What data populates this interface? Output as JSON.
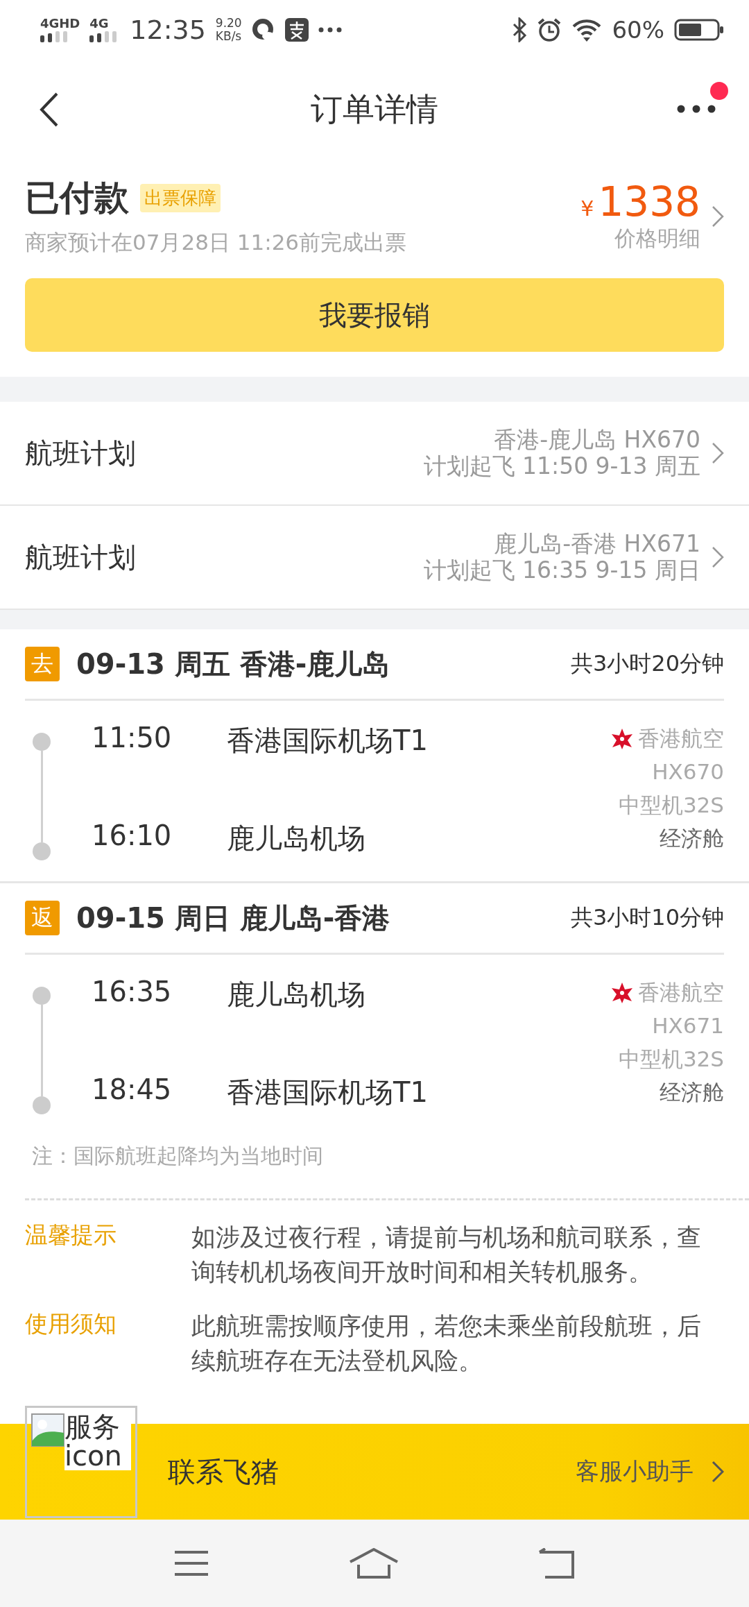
{
  "status_bar": {
    "network_1": "4GHD",
    "network_2": "4G",
    "time": "12:35",
    "speed": "9.20",
    "speed_unit": "KB/s",
    "battery": "60%"
  },
  "header": {
    "title": "订单详情",
    "notification_dot": true
  },
  "order": {
    "status": "已付款",
    "tag": "出票保障",
    "note": "商家预计在07月28日 11:26前完成出票",
    "price_currency": "¥",
    "price": "1338",
    "price_link": "价格明细",
    "button": "我要报销"
  },
  "flight_plans": [
    {
      "label": "航班计划",
      "route": "香港-鹿儿岛 HX670",
      "schedule": "计划起飞 11:50 9-13 周五"
    },
    {
      "label": "航班计划",
      "route": "鹿儿岛-香港 HX671",
      "schedule": "计划起飞 16:35 9-15 周日"
    }
  ],
  "segments": [
    {
      "badge": "去",
      "title": "09-13 周五 香港-鹿儿岛",
      "duration": "共3小时20分钟",
      "depart_time": "11:50",
      "depart_airport": "香港国际机场T1",
      "arrive_time": "16:10",
      "arrive_airport": "鹿儿岛机场",
      "airline": "香港航空",
      "flight_no": "HX670",
      "aircraft": "中型机32S",
      "cabin": "经济舱"
    },
    {
      "badge": "返",
      "title": "09-15 周日 鹿儿岛-香港",
      "duration": "共3小时10分钟",
      "depart_time": "16:35",
      "depart_airport": "鹿儿岛机场",
      "arrive_time": "18:45",
      "arrive_airport": "香港国际机场T1",
      "airline": "香港航空",
      "flight_no": "HX671",
      "aircraft": "中型机32S",
      "cabin": "经济舱"
    }
  ],
  "footnote": "注：国际航班起降均为当地时间",
  "tips": [
    {
      "label": "温馨提示",
      "text": "如涉及过夜行程，请提前与机场和航司联系，查询转机机场夜间开放时间和相关转机服务。"
    },
    {
      "label": "使用须知",
      "text": "此航班需按顺序使用，若您未乘坐前段航班，后续航班存在无法登机风险。"
    }
  ],
  "contact_bar": {
    "image_alt": "服务 icon",
    "label": "联系飞猪",
    "link": "客服小助手"
  }
}
